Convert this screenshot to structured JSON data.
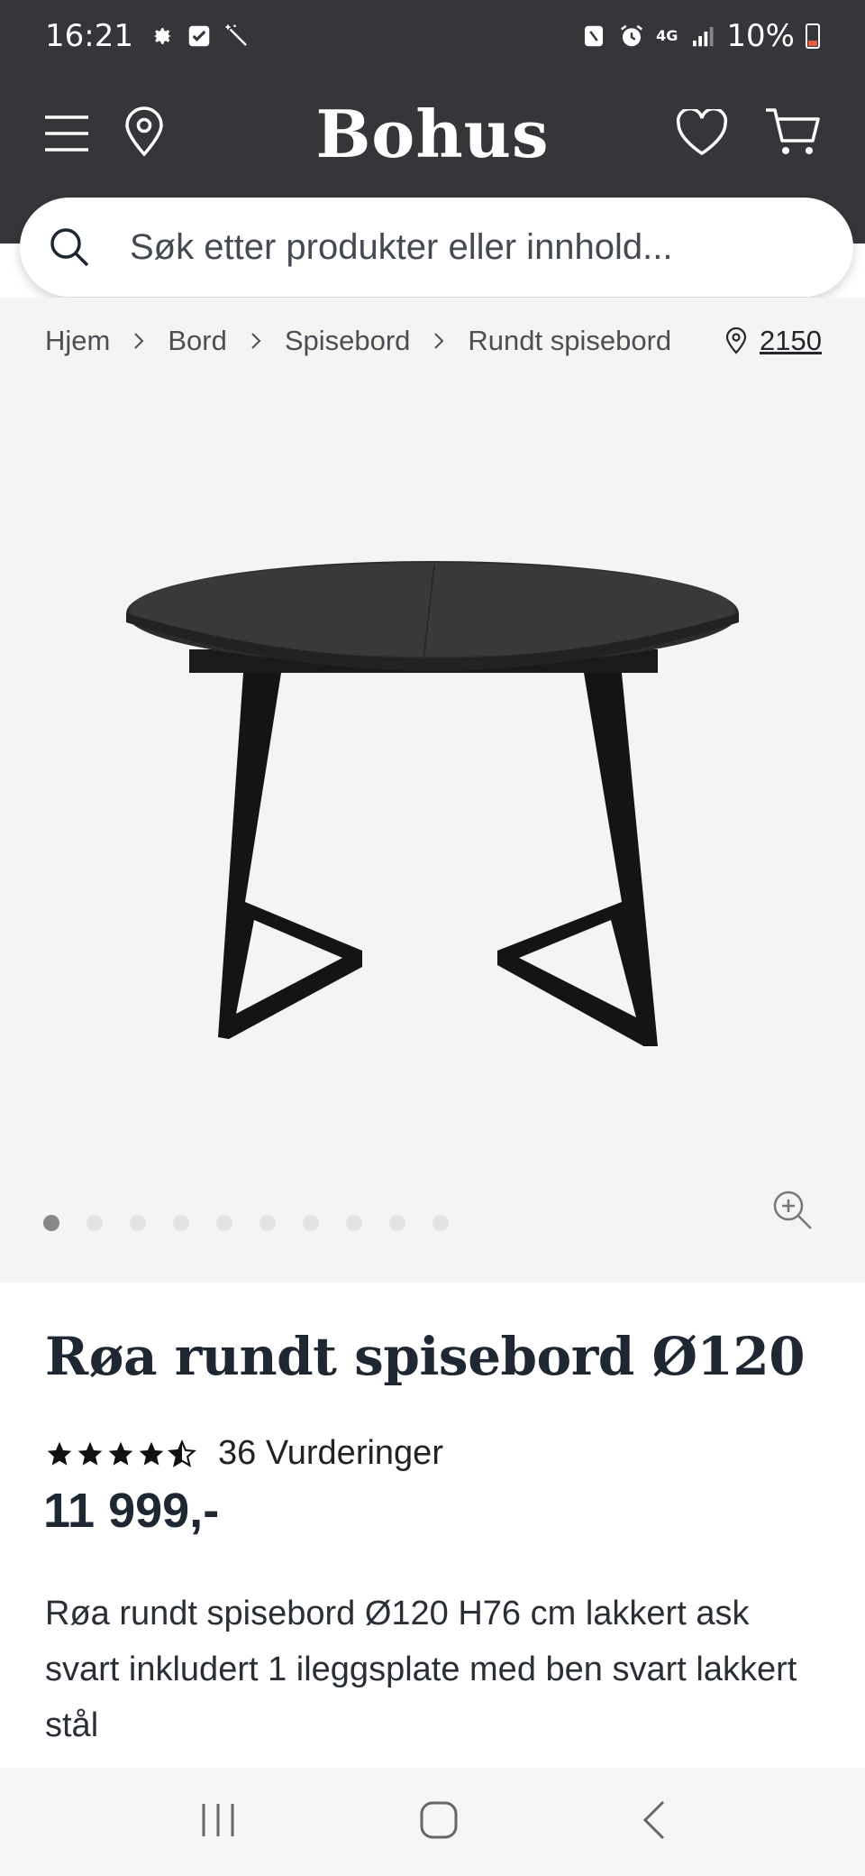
{
  "status_bar": {
    "time": "16:21",
    "network": "4G",
    "battery": "10%"
  },
  "header": {
    "logo": "Bohus"
  },
  "search": {
    "placeholder": "Søk etter produkter eller innhold..."
  },
  "breadcrumb": {
    "items": [
      "Hjem",
      "Bord",
      "Spisebord",
      "Rundt spisebord"
    ]
  },
  "location": {
    "postal_code": "2150"
  },
  "gallery": {
    "total_images": 10,
    "active_index": 0
  },
  "product": {
    "title": "Røa rundt spisebord Ø120",
    "rating": 4.5,
    "rating_count_label": "36 Vurderinger",
    "price": "11 999,-",
    "description": "Røa rundt spisebord Ø120 H76 cm lakkert ask svart inkludert 1 ileggsplate med ben svart lakkert stål"
  },
  "colors": {
    "header_bg": "#36363a",
    "product_bg": "#f5f4f2",
    "text_dark": "#1e2732"
  }
}
